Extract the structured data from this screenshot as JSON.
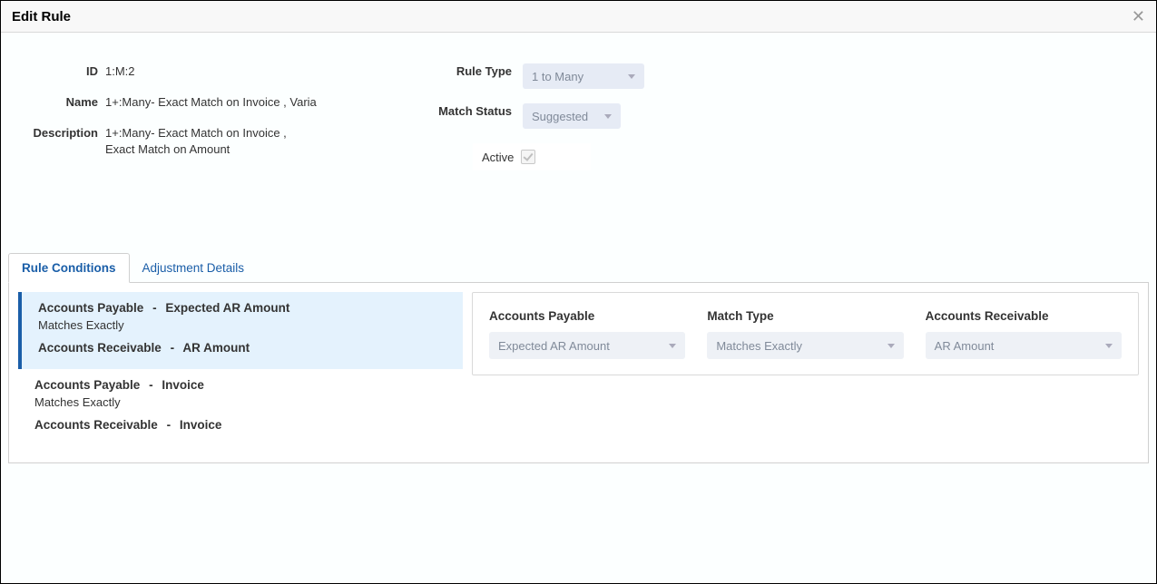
{
  "dialog": {
    "title": "Edit Rule"
  },
  "form": {
    "id_label": "ID",
    "id_value": "1:M:2",
    "name_label": "Name",
    "name_value": "1+:Many- Exact Match on Invoice , Varia",
    "description_label": "Description",
    "description_value": "1+:Many- Exact Match on Invoice , Exact Match on Amount",
    "rule_type_label": "Rule Type",
    "rule_type_value": "1 to Many",
    "match_status_label": "Match Status",
    "match_status_value": "Suggested",
    "active_label": "Active"
  },
  "tabs": {
    "rule_conditions": "Rule Conditions",
    "adjustment_details": "Adjustment Details"
  },
  "conditions": [
    {
      "ap_label": "Accounts Payable",
      "ap_field": "Expected AR Amount",
      "match_text": "Matches Exactly",
      "ar_label": "Accounts Receivable",
      "ar_field": "AR Amount",
      "selected": true
    },
    {
      "ap_label": "Accounts Payable",
      "ap_field": "Invoice",
      "match_text": "Matches Exactly",
      "ar_label": "Accounts Receivable",
      "ar_field": "Invoice",
      "selected": false
    }
  ],
  "detail": {
    "ap_header": "Accounts Payable",
    "ap_value": "Expected AR Amount",
    "match_header": "Match Type",
    "match_value": "Matches Exactly",
    "ar_header": "Accounts Receivable",
    "ar_value": "AR Amount"
  }
}
